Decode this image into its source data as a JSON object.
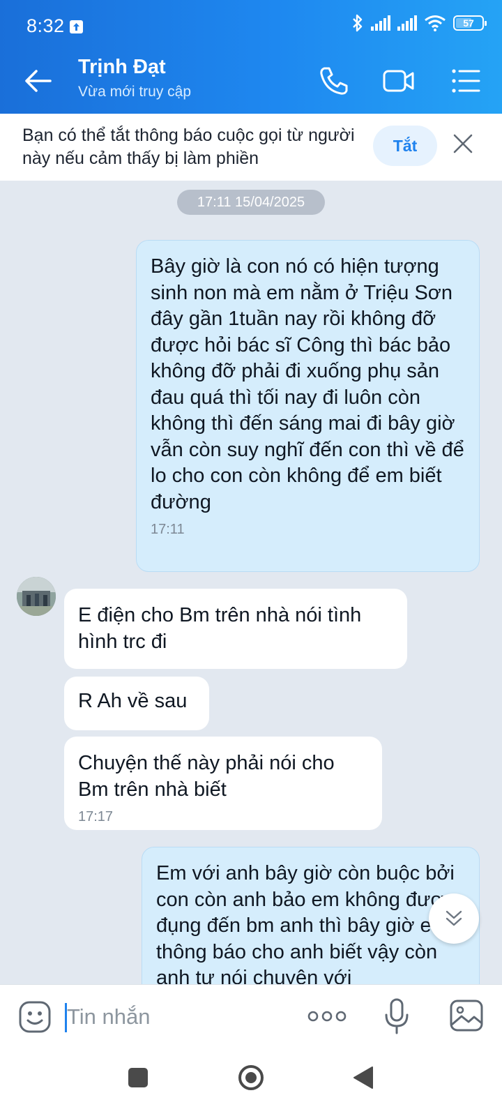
{
  "status_bar": {
    "time": "8:32",
    "battery": "57"
  },
  "header": {
    "back_icon": "arrow-left-icon",
    "name": "Trịnh Đạt",
    "status": "Vừa mới truy cập",
    "actions": [
      "phone-icon",
      "video-call-icon",
      "menu-list-icon"
    ]
  },
  "notice": {
    "text": "Bạn có thể tắt thông báo cuộc gọi từ người này nếu cảm thấy bị làm phiền",
    "button": "Tắt",
    "close_icon": "close-icon"
  },
  "chat": {
    "date_divider": "17:11 15/04/2025",
    "messages": [
      {
        "direction": "out",
        "text": "Bây giờ là con nó có hiện tượng sinh non mà em nằm ở Triệu Sơn đây gần 1tuần nay rồi không đỡ được hỏi bác sĩ Công thì bác bảo không đỡ phải đi xuống phụ sản đau quá thì tối nay đi luôn còn không thì đến sáng mai đi bây giờ vẫn còn suy nghĩ đến con thì về để lo cho con còn không để em biết đường",
        "time": "17:11"
      },
      {
        "direction": "in",
        "text": "E điện cho Bm trên nhà nói tình hình trc đi",
        "time": ""
      },
      {
        "direction": "in",
        "text": "R Ah về sau",
        "time": ""
      },
      {
        "direction": "in",
        "text": "Chuyện  thế này phải nói cho Bm trên nhà biết",
        "time": "17:17"
      },
      {
        "direction": "out",
        "text": "Em với anh bây giờ còn buộc bởi con còn anh bảo em không được đụng đến bm anh thì bây giờ em thông báo cho anh biết vậy còn anh tự nói chuyện với",
        "time": ""
      }
    ],
    "scroll_down_icon": "double-chevron-down-icon"
  },
  "composer": {
    "placeholder": "Tin nhắn",
    "icons": [
      "emoji-icon",
      "more-icon",
      "microphone-icon",
      "image-icon"
    ]
  },
  "colors": {
    "header_start": "#1a6fd9",
    "header_end": "#25a3f5",
    "outgoing_bubble": "#d5edfc",
    "incoming_bubble": "#ffffff",
    "chat_background": "#e2e8f0",
    "accent": "#1f82ee"
  }
}
